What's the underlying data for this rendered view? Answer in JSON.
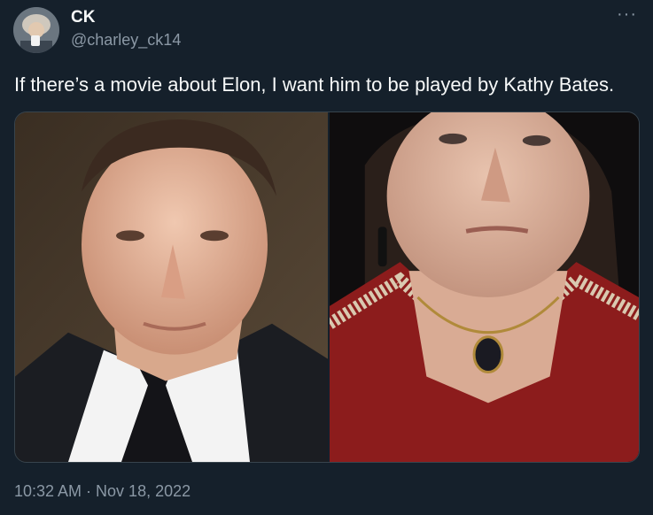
{
  "author": {
    "name": "CK",
    "handle": "@charley_ck14"
  },
  "menu": {
    "icon": "more-dots-icon",
    "label": "···"
  },
  "tweet": {
    "text": "If there’s a movie about Elon, I want him to be played by Kathy Bates.",
    "timestamp": "10:32 AM · Nov 18, 2022"
  },
  "colors": {
    "background": "#15202b",
    "text": "#f7f9f9",
    "secondary": "#8b98a5"
  }
}
